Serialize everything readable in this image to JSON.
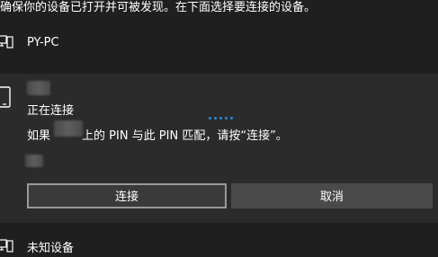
{
  "instruction": "确保你的设备已打开并可被发现。在下面选择要连接的设备。",
  "devices": [
    {
      "name": "PY-PC",
      "icon": "desktop-computer-icon"
    },
    {
      "name": "未知设备",
      "icon": "desktop-computer-icon"
    }
  ],
  "pairing": {
    "icon": "phone-icon",
    "status": "正在连接",
    "pin_prefix": "如果",
    "pin_suffix": "上的 PIN 与此 PIN 匹配，请按“连接”。",
    "connect_label": "连接",
    "cancel_label": "取消"
  },
  "colors": {
    "background": "#1f1f1f",
    "panel": "#2b2b2b",
    "accent": "#2f86d6",
    "connect_button": "#3a3a3a",
    "cancel_button": "#4a4a4a"
  }
}
